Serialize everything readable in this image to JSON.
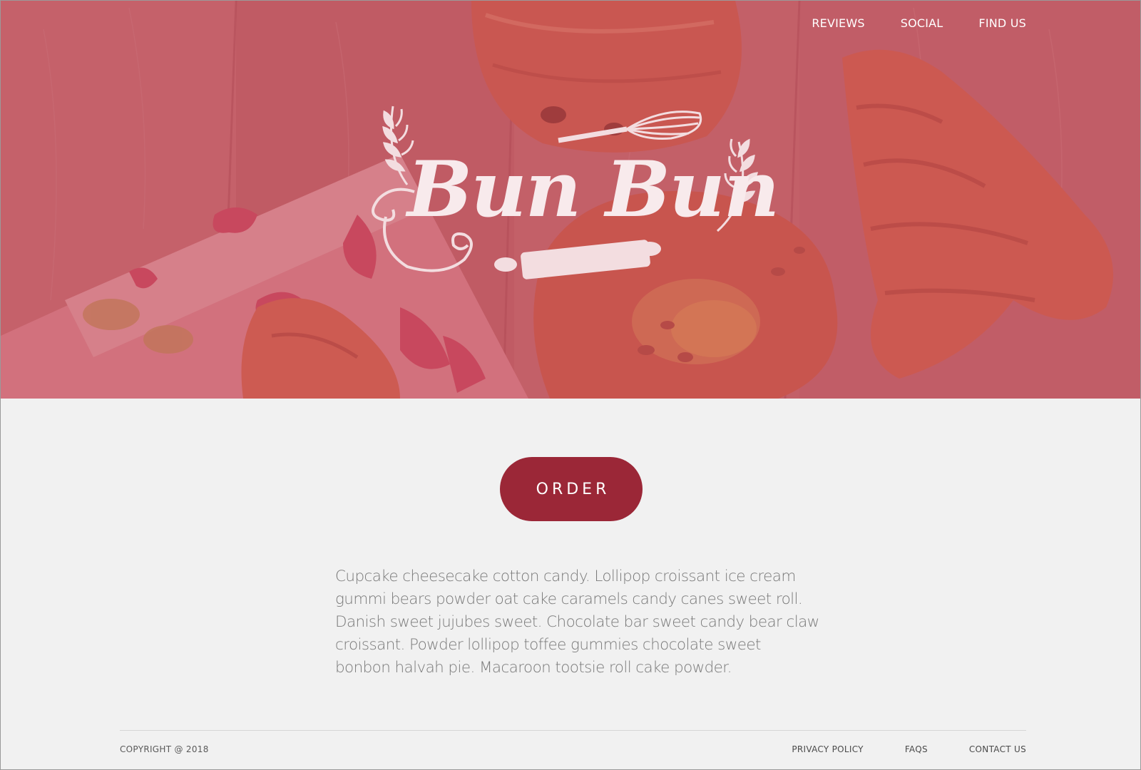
{
  "brand": {
    "name": "Bun Bun",
    "accent_color": "#9b2737",
    "hero_overlay_color": "#b8404f"
  },
  "nav": {
    "items": [
      {
        "label": "REVIEWS"
      },
      {
        "label": "SOCIAL"
      },
      {
        "label": "FIND US"
      }
    ]
  },
  "hero": {
    "logo_icons": [
      "wheat-icon",
      "whisk-icon",
      "rolling-pin-icon",
      "swirl-icon"
    ],
    "background_subject": "pastries-on-wooden-table"
  },
  "main": {
    "order_label": "ORDER",
    "description": "Cupcake cheesecake cotton candy. Lollipop croissant ice cream gummi bears powder oat cake caramels candy canes sweet roll. Danish sweet jujubes sweet. Chocolate bar sweet candy bear claw croissant. Powder lollipop toffee gummies chocolate sweet bonbon halvah pie. Macaroon tootsie roll cake powder."
  },
  "footer": {
    "copyright": "COPYRIGHT @ 2018",
    "links": [
      {
        "label": "PRIVACY POLICY"
      },
      {
        "label": "FAQS"
      },
      {
        "label": "CONTACT US"
      }
    ]
  }
}
